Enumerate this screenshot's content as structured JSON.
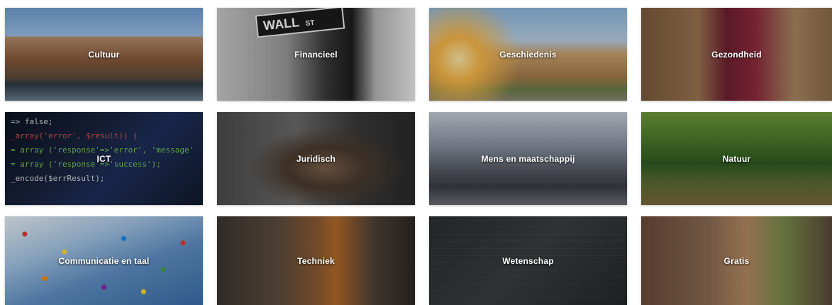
{
  "categories": [
    {
      "label": "Cultuur",
      "image": "canal-houses"
    },
    {
      "label": "Financieel",
      "image": "wall-street-sign"
    },
    {
      "label": "Geschiedenis",
      "image": "colosseum"
    },
    {
      "label": "Gezondheid",
      "image": "medical-desk"
    },
    {
      "label": "ICT",
      "image": "source-code"
    },
    {
      "label": "Juridisch",
      "image": "lady-justice"
    },
    {
      "label": "Mens en maatschappij",
      "image": "busy-street"
    },
    {
      "label": "Natuur",
      "image": "forest-path"
    },
    {
      "label": "Communicatie en taal",
      "image": "world-flags"
    },
    {
      "label": "Techniek",
      "image": "mitre-saw"
    },
    {
      "label": "Wetenschap",
      "image": "chalkboard-formulas"
    },
    {
      "label": "Gratis",
      "image": "cartoon-toys"
    }
  ],
  "decor": {
    "wall_sign_text": "WALL",
    "wall_sign_suffix": "ST",
    "code": {
      "line1": "=> false;",
      "line2": "_array('error', $result)) {",
      "line3": "= array ('response'=>'error', 'message'",
      "line4": "= array ('response'=>'success');",
      "line5": "_encode($errResult);"
    }
  }
}
